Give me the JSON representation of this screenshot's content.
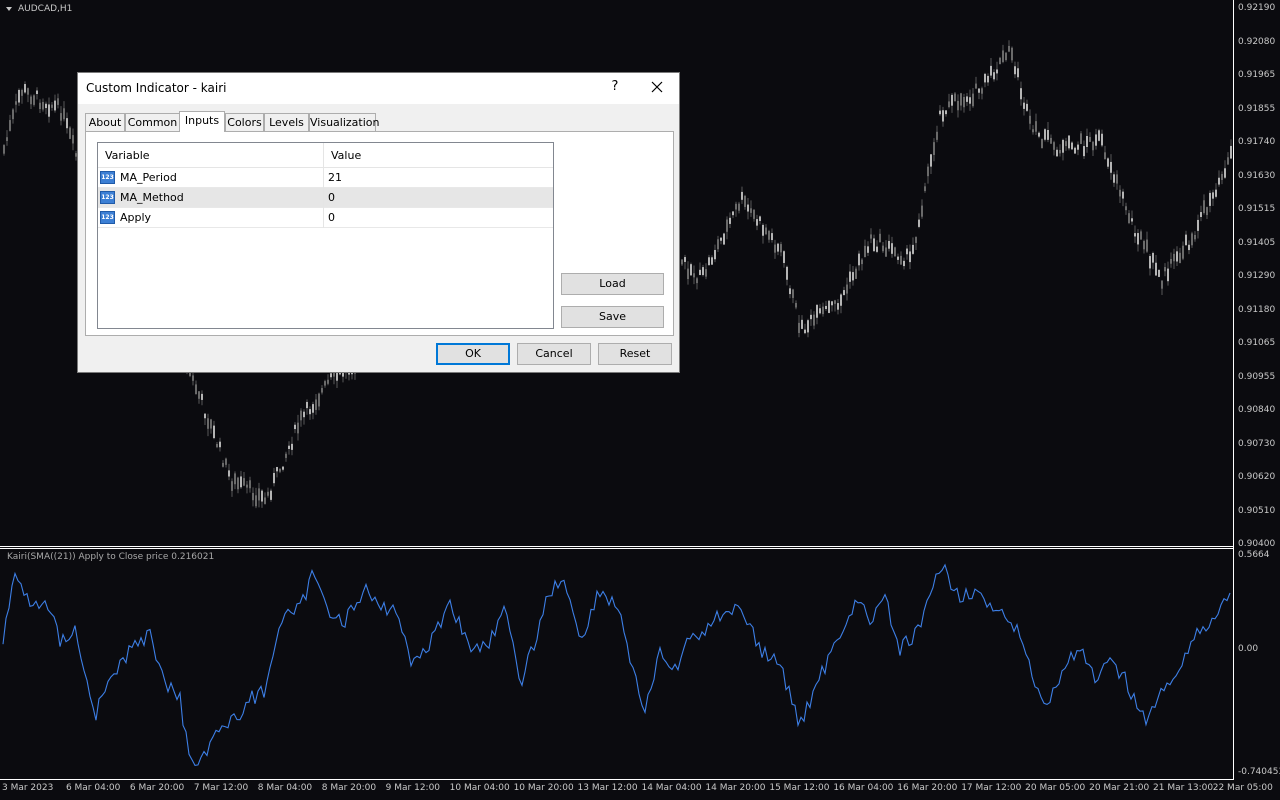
{
  "chart": {
    "title": "AUDCAD,H1",
    "indicator_label": "Kairi(SMA((21)) Apply to Close price 0.216021",
    "price_axis": [
      "0.92190",
      "0.92080",
      "0.91965",
      "0.91855",
      "0.91740",
      "0.91630",
      "0.91515",
      "0.91405",
      "0.91290",
      "0.91180",
      "0.91065",
      "0.90955",
      "0.90840",
      "0.90730",
      "0.90620",
      "0.90510",
      "0.90400"
    ],
    "indicator_axis": [
      "0.5664",
      "0.00",
      "-0.740453"
    ],
    "time_axis": [
      "3 Mar 2023",
      "6 Mar 04:00",
      "6 Mar 20:00",
      "7 Mar 12:00",
      "8 Mar 04:00",
      "8 Mar 20:00",
      "9 Mar 12:00",
      "10 Mar 04:00",
      "10 Mar 20:00",
      "13 Mar 12:00",
      "14 Mar 04:00",
      "14 Mar 20:00",
      "15 Mar 12:00",
      "16 Mar 04:00",
      "16 Mar 20:00",
      "17 Mar 12:00",
      "20 Mar 05:00",
      "20 Mar 21:00",
      "21 Mar 13:00",
      "22 Mar 05:00"
    ],
    "colors": {
      "background": "#0b0b0f",
      "candle": "#8c8c8c",
      "indicator_line": "#3d7fe6",
      "frame": "#ffffff"
    }
  },
  "dialog": {
    "title": "Custom Indicator - kairi",
    "help_label": "?",
    "close_icon": "close-icon",
    "tabs": [
      {
        "label": "About"
      },
      {
        "label": "Common"
      },
      {
        "label": "Inputs"
      },
      {
        "label": "Colors"
      },
      {
        "label": "Levels"
      },
      {
        "label": "Visualization"
      }
    ],
    "active_tab": "Inputs",
    "grid": {
      "col_variable": "Variable",
      "col_value": "Value",
      "row_icon": "integer-123-icon",
      "rows": [
        {
          "variable": "MA_Period",
          "value": "21"
        },
        {
          "variable": "MA_Method",
          "value": "0"
        },
        {
          "variable": "Apply",
          "value": "0"
        }
      ],
      "selected_row": "MA_Method"
    },
    "load_label": "Load",
    "save_label": "Save",
    "ok_label": "OK",
    "cancel_label": "Cancel",
    "reset_label": "Reset"
  }
}
